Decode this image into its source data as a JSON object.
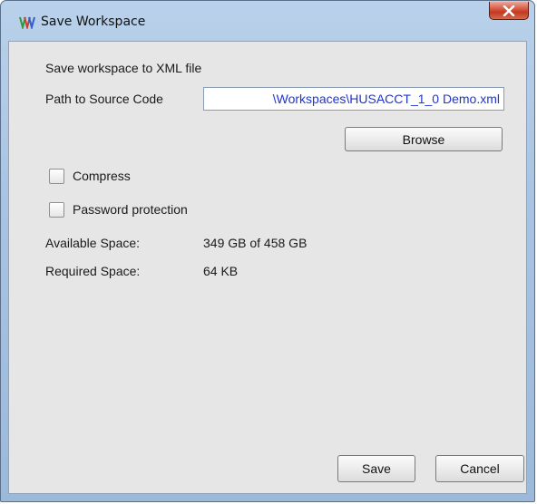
{
  "window": {
    "title": "Save Workspace",
    "icons": {
      "app": "husacct-app-icon",
      "close": "close-icon"
    }
  },
  "dialog": {
    "heading": "Save workspace to XML file",
    "path_label": "Path to Source Code",
    "path_value": "\\Workspaces\\HUSACCT_1_0 Demo.xml",
    "browse_label": "Browse",
    "compress_label": "Compress",
    "compress_checked": false,
    "password_label": "Password protection",
    "password_checked": false,
    "available_label": "Available Space:",
    "available_value": "349 GB of 458 GB",
    "required_label": "Required Space:",
    "required_value": "64 KB",
    "save_label": "Save",
    "cancel_label": "Cancel"
  },
  "colors": {
    "path_text": "#1e34d6",
    "panel_bg": "#e6e6e6",
    "close_red": "#c13a22"
  }
}
